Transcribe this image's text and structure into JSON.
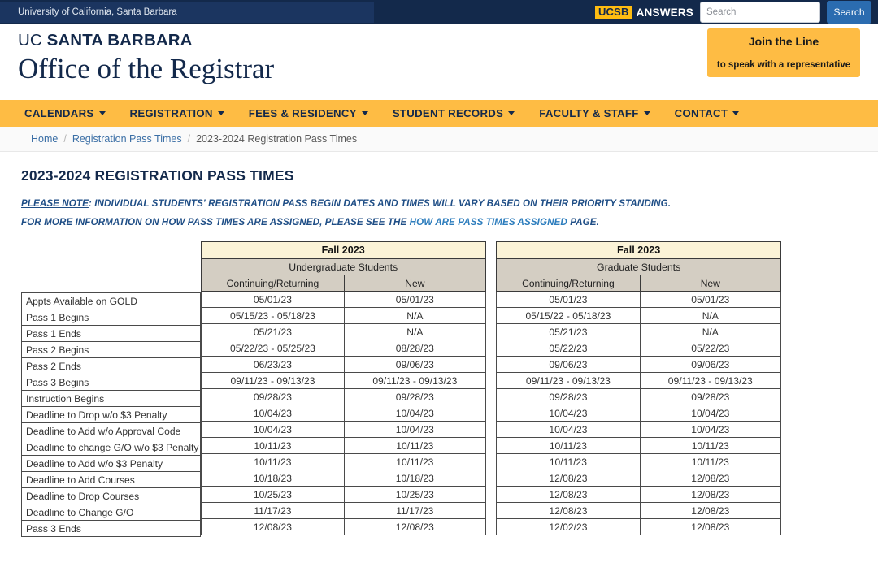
{
  "topbar": {
    "university": "University of California, Santa Barbara",
    "answers_mark": "UCSB",
    "answers_word": "ANSWERS",
    "search_placeholder": "Search",
    "search_value": "",
    "search_button": "Search"
  },
  "masthead": {
    "wordmark_light": "UC ",
    "wordmark_bold": "SANTA BARBARA",
    "site_title": "Office of the Registrar",
    "join_title": "Join the Line",
    "join_sub": "to speak with a representative"
  },
  "nav": {
    "items": [
      {
        "label": "CALENDARS"
      },
      {
        "label": "REGISTRATION"
      },
      {
        "label": "FEES & RESIDENCY"
      },
      {
        "label": "STUDENT RECORDS"
      },
      {
        "label": "FACULTY & STAFF"
      },
      {
        "label": "CONTACT"
      }
    ]
  },
  "breadcrumb": {
    "home": "Home",
    "sep": "/",
    "parent": "Registration Pass Times",
    "current": "2023-2024 Registration Pass Times"
  },
  "page": {
    "title": "2023-2024 REGISTRATION PASS TIMES",
    "note1_lead": "PLEASE NOTE",
    "note1_rest": ": INDIVIDUAL STUDENTS' REGISTRATION PASS BEGIN DATES AND TIMES WILL VARY BASED ON THEIR PRIORITY STANDING.",
    "note2_pre": "FOR MORE INFORMATION ON HOW PASS TIMES ARE ASSIGNED, PLEASE SEE THE ",
    "note2_link": "HOW ARE PASS TIMES ASSIGNED",
    "note2_post": " PAGE."
  },
  "colors": {
    "navy": "#13294b",
    "gold": "#febc44",
    "term_band": "#fbf3d7",
    "header_gray": "#d4cec3",
    "link_blue": "#3a6ea5"
  },
  "table": {
    "term": "Fall 2023",
    "groups": [
      {
        "label": "Undergraduate Students",
        "subcolumns": [
          "Continuing/Returning",
          "New"
        ]
      },
      {
        "label": "Graduate Students",
        "subcolumns": [
          "Continuing/Returning",
          "New"
        ]
      }
    ],
    "rows": [
      {
        "label": "Appts Available on GOLD",
        "ug_cont": "05/01/23",
        "ug_new": "05/01/23",
        "gr_cont": "05/01/23",
        "gr_new": "05/01/23"
      },
      {
        "label": "Pass 1 Begins",
        "ug_cont": "05/15/23 - 05/18/23",
        "ug_new": "N/A",
        "gr_cont": "05/15/22 - 05/18/23",
        "gr_new": "N/A"
      },
      {
        "label": "Pass 1 Ends",
        "ug_cont": "05/21/23",
        "ug_new": "N/A",
        "gr_cont": "05/21/23",
        "gr_new": "N/A"
      },
      {
        "label": "Pass 2 Begins",
        "ug_cont": "05/22/23 - 05/25/23",
        "ug_new": "08/28/23",
        "gr_cont": "05/22/23",
        "gr_new": "05/22/23"
      },
      {
        "label": "Pass 2 Ends",
        "ug_cont": "06/23/23",
        "ug_new": "09/06/23",
        "gr_cont": "09/06/23",
        "gr_new": "09/06/23"
      },
      {
        "label": "Pass 3 Begins",
        "ug_cont": "09/11/23 - 09/13/23",
        "ug_new": "09/11/23 - 09/13/23",
        "gr_cont": "09/11/23 - 09/13/23",
        "gr_new": "09/11/23 - 09/13/23"
      },
      {
        "label": "Instruction Begins",
        "ug_cont": "09/28/23",
        "ug_new": "09/28/23",
        "gr_cont": "09/28/23",
        "gr_new": "09/28/23"
      },
      {
        "label": "Deadline to Drop w/o $3 Penalty",
        "ug_cont": "10/04/23",
        "ug_new": "10/04/23",
        "gr_cont": "10/04/23",
        "gr_new": "10/04/23"
      },
      {
        "label": "Deadline to Add w/o Approval Code",
        "ug_cont": "10/04/23",
        "ug_new": "10/04/23",
        "gr_cont": "10/04/23",
        "gr_new": "10/04/23"
      },
      {
        "label": "Deadline to change G/O w/o $3 Penalty",
        "ug_cont": "10/11/23",
        "ug_new": "10/11/23",
        "gr_cont": "10/11/23",
        "gr_new": "10/11/23"
      },
      {
        "label": "Deadline to Add w/o $3 Penalty",
        "ug_cont": "10/11/23",
        "ug_new": "10/11/23",
        "gr_cont": "10/11/23",
        "gr_new": "10/11/23"
      },
      {
        "label": "Deadline to Add Courses",
        "ug_cont": "10/18/23",
        "ug_new": "10/18/23",
        "gr_cont": "12/08/23",
        "gr_new": "12/08/23"
      },
      {
        "label": "Deadline to Drop Courses",
        "ug_cont": "10/25/23",
        "ug_new": "10/25/23",
        "gr_cont": "12/08/23",
        "gr_new": "12/08/23"
      },
      {
        "label": "Deadline to Change G/O",
        "ug_cont": "11/17/23",
        "ug_new": "11/17/23",
        "gr_cont": "12/08/23",
        "gr_new": "12/08/23"
      },
      {
        "label": "Pass 3 Ends",
        "ug_cont": "12/08/23",
        "ug_new": "12/08/23",
        "gr_cont": "12/02/23",
        "gr_new": "12/08/23"
      }
    ]
  }
}
